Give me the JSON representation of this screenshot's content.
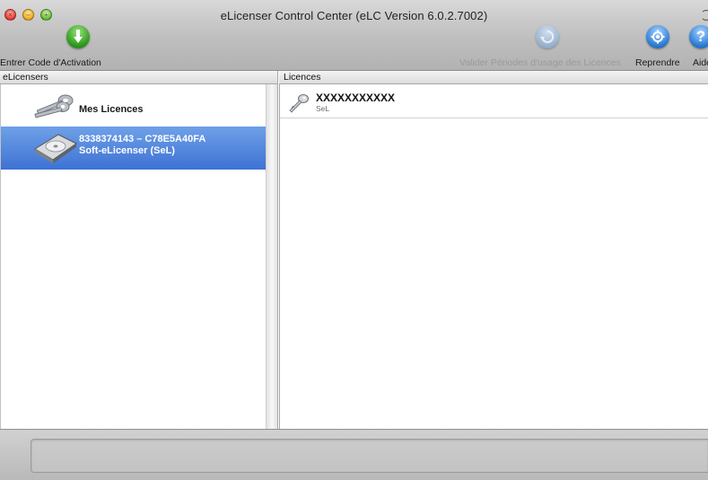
{
  "window": {
    "title": "eLicenser Control Center (eLC Version 6.0.2.7002)"
  },
  "toolbar": {
    "activation_label": "Entrer Code d'Activation",
    "validate_label": "Valider Périodes d'usage des Licences",
    "restore_label": "Reprendre",
    "help_label": "Aide"
  },
  "columns": {
    "left_header": "eLicensers",
    "right_header": "Licences"
  },
  "elicensers": [
    {
      "line1": "Mes Licences",
      "icon": "keys-icon"
    },
    {
      "line1": "8338374143 – C78E5A40FA",
      "line2": "Soft-eLicenser (SeL)",
      "icon": "hard-drive-icon",
      "selected": true
    }
  ],
  "licences": [
    {
      "name": "XXXXXXXXXXX",
      "sub": "SeL",
      "icon": "key-icon"
    }
  ],
  "colors": {
    "selection": "#3d72d4",
    "toolbar_green": "#2f9c1e",
    "toolbar_blue": "#2f7fd6"
  }
}
